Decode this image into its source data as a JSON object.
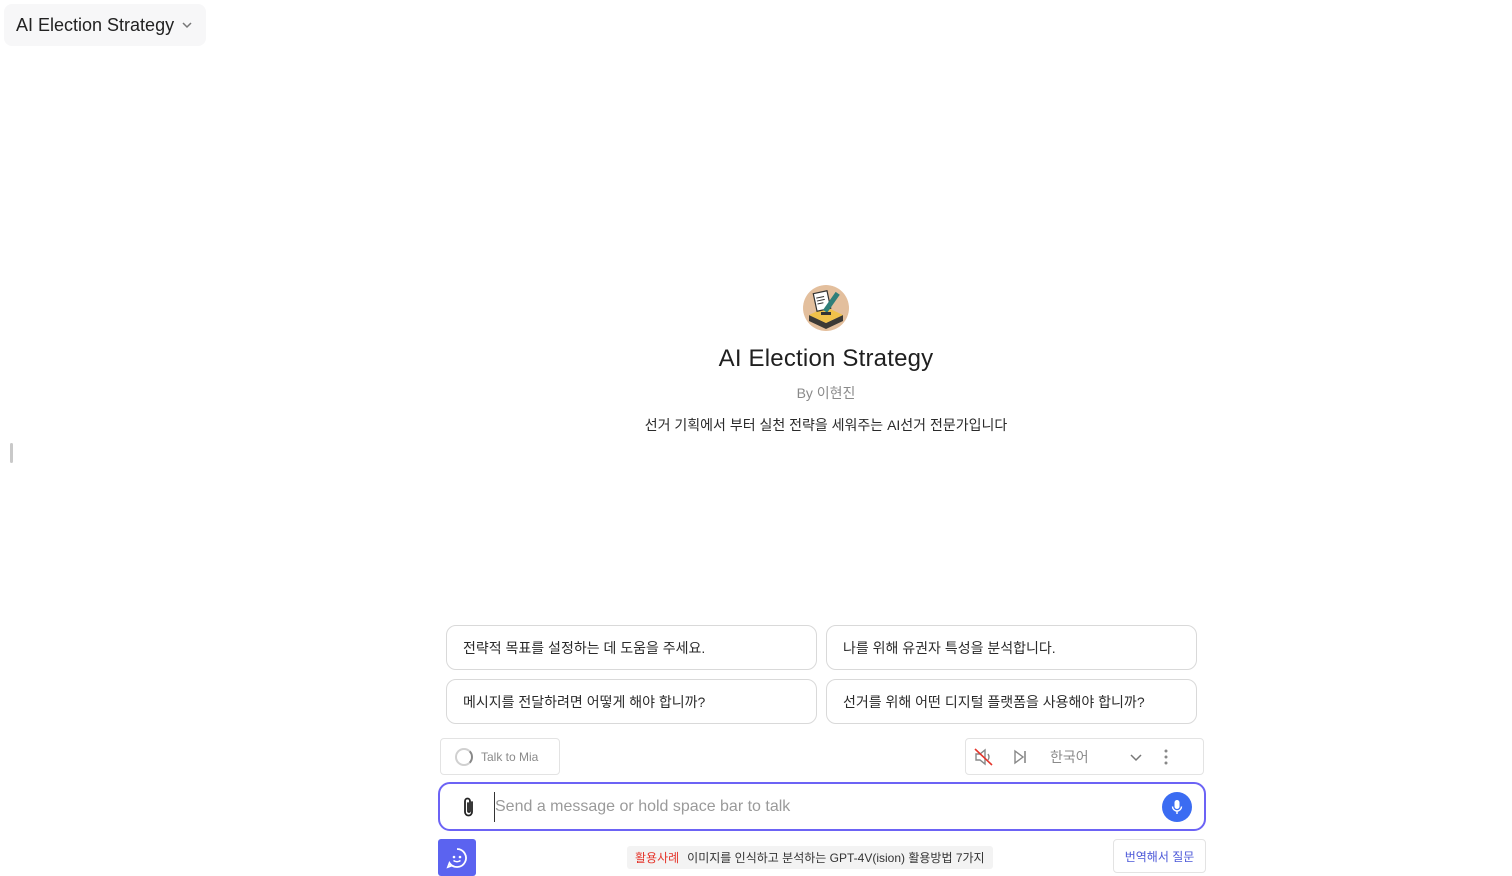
{
  "header": {
    "model_name": "AI Election Strategy"
  },
  "intro": {
    "avatar_icon": "ballot-box-icon",
    "title": "AI Election Strategy",
    "by_prefix": "By",
    "author": "이현진",
    "description": "선거 기획에서 부터 실천 전략을 세워주는 AI선거 전문가입니다"
  },
  "suggestions": [
    "전략적 목표를 설정하는 데 도움을 주세요.",
    "나를 위해 유권자 특성을 분석합니다.",
    "메시지를 전달하려면 어떻게 해야 합니까?",
    "선거를 위해 어떤 디지털 플랫폼을 사용해야 합니까?"
  ],
  "voice": {
    "talk_label": "Talk to Mia",
    "language": "한국어"
  },
  "composer": {
    "placeholder": "Send a message or hold space bar to talk",
    "value": ""
  },
  "footer": {
    "promo_tag": "활용사례",
    "promo_text": "이미지를 인식하고 분석하는 GPT-4V(ision) 활용방법 7가지",
    "translate_label": "번역해서 질문"
  },
  "colors": {
    "accent": "#6c63f5",
    "mic": "#3b6cf2",
    "bot": "#5b63f0",
    "promo_tag": "#e5352b",
    "mute_slash": "#e5352b"
  }
}
